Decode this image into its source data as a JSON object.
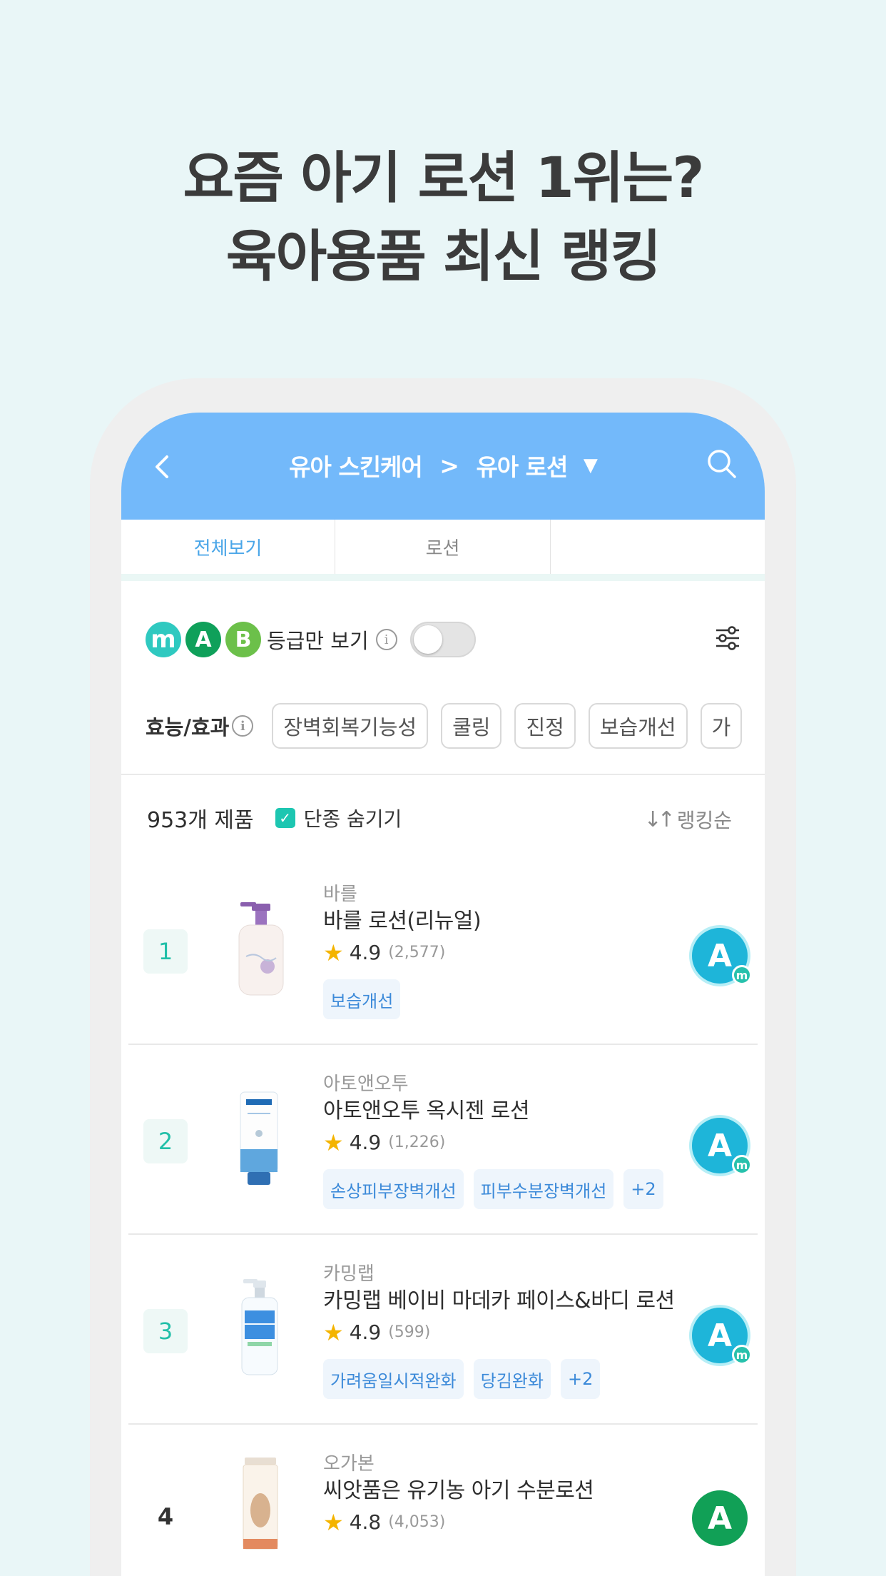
{
  "headline": {
    "line1": "요즘 아기 로션 1위는?",
    "line2": "육아용품 최신 랭킹"
  },
  "header": {
    "category": "유아 스킨케어",
    "separator": ">",
    "subcategory": "유아 로션",
    "caret": "▼",
    "accent_color": "#73b9fa"
  },
  "tabs": [
    {
      "label": "전체보기",
      "active": true
    },
    {
      "label": "로션",
      "active": false
    },
    {
      "label": "",
      "active": false
    }
  ],
  "grade_filter": {
    "grades": [
      "m",
      "A",
      "B"
    ],
    "label": "등급만 보기",
    "info": "i",
    "toggle_on": false
  },
  "effects": {
    "label": "효능/효과",
    "info": "i",
    "chips": [
      "장벽회복기능성",
      "쿨링",
      "진정",
      "보습개선",
      "가"
    ]
  },
  "list_header": {
    "count": "953개 제품",
    "hide_discontinued_label": "단종 숨기기",
    "hide_discontinued_checked": true,
    "checkmark": "✓",
    "sort_label": "랭킹순",
    "sort_icon": "↓↑"
  },
  "products": [
    {
      "rank": "1",
      "brand": "바를",
      "name": "바를 로션(리뉴얼)",
      "star": "★",
      "rating": "4.9",
      "reviews": "(2,577)",
      "tags": [
        "보습개선"
      ],
      "grade": "A",
      "grade_sub": "m"
    },
    {
      "rank": "2",
      "brand": "아토앤오투",
      "name": "아토앤오투 옥시젠 로션",
      "star": "★",
      "rating": "4.9",
      "reviews": "(1,226)",
      "tags": [
        "손상피부장벽개선",
        "피부수분장벽개선",
        "+2"
      ],
      "grade": "A",
      "grade_sub": "m"
    },
    {
      "rank": "3",
      "brand": "카밍랩",
      "name": "카밍랩 베이비 마데카 페이스&바디 로션",
      "star": "★",
      "rating": "4.9",
      "reviews": "(599)",
      "tags": [
        "가려움일시적완화",
        "당김완화",
        "+2"
      ],
      "grade": "A",
      "grade_sub": "m"
    },
    {
      "rank": "4",
      "brand": "오가본",
      "name": "씨앗품은 유기농 아기 수분로션",
      "star": "★",
      "rating": "4.8",
      "reviews": "(4,053)",
      "tags": [],
      "grade": "A",
      "grade_sub": ""
    }
  ]
}
